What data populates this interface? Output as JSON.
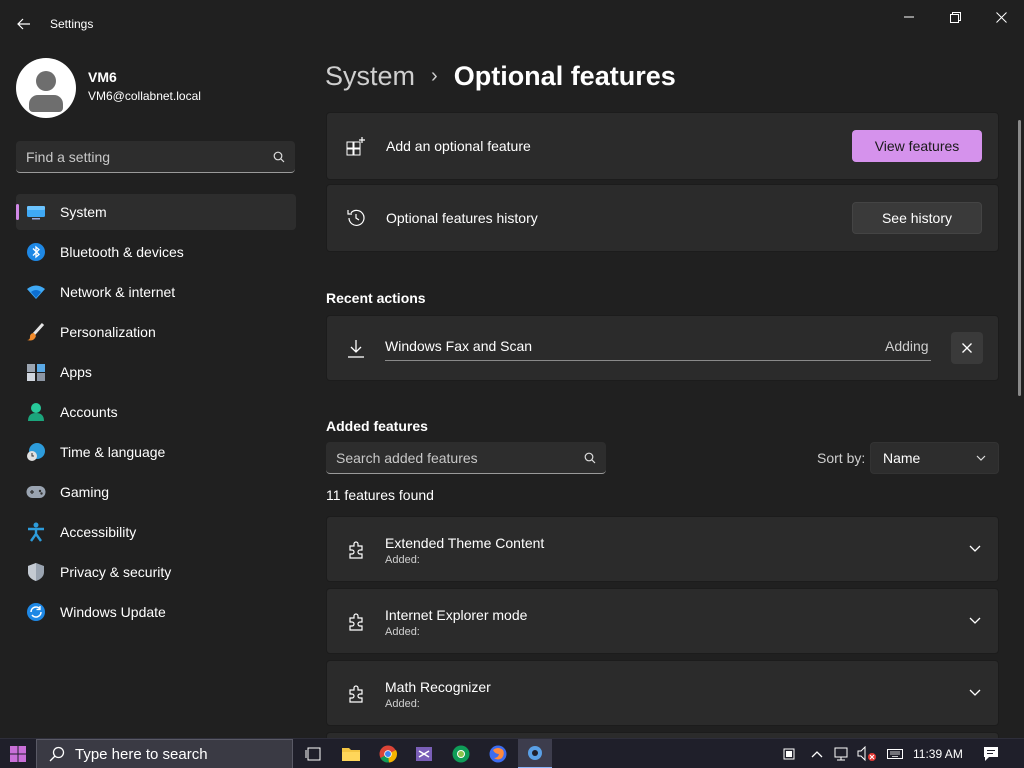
{
  "window": {
    "app_title": "Settings"
  },
  "profile": {
    "name": "VM6",
    "email": "VM6@collabnet.local"
  },
  "sidebar": {
    "search_placeholder": "Find a setting",
    "items": [
      {
        "label": "System",
        "icon": "monitor-icon",
        "active": true
      },
      {
        "label": "Bluetooth & devices",
        "icon": "bluetooth-icon"
      },
      {
        "label": "Network & internet",
        "icon": "wifi-icon"
      },
      {
        "label": "Personalization",
        "icon": "brush-icon"
      },
      {
        "label": "Apps",
        "icon": "apps-icon"
      },
      {
        "label": "Accounts",
        "icon": "person-icon"
      },
      {
        "label": "Time & language",
        "icon": "globe-clock-icon"
      },
      {
        "label": "Gaming",
        "icon": "gamepad-icon"
      },
      {
        "label": "Accessibility",
        "icon": "accessibility-icon"
      },
      {
        "label": "Privacy & security",
        "icon": "shield-icon"
      },
      {
        "label": "Windows Update",
        "icon": "update-icon"
      }
    ]
  },
  "breadcrumb": {
    "parent": "System",
    "separator": "›",
    "current": "Optional features"
  },
  "add_feature": {
    "label": "Add an optional feature",
    "button": "View features"
  },
  "history": {
    "label": "Optional features history",
    "button": "See history"
  },
  "recent": {
    "title": "Recent actions",
    "item_name": "Windows Fax and Scan",
    "item_status": "Adding"
  },
  "added": {
    "title": "Added features",
    "search_placeholder": "Search added features",
    "sort_label": "Sort by:",
    "sort_value": "Name",
    "count_text": "11 features found",
    "features": [
      {
        "name": "Extended Theme Content",
        "status": "Added:"
      },
      {
        "name": "Internet Explorer mode",
        "status": "Added:"
      },
      {
        "name": "Math Recognizer",
        "status": "Added:"
      }
    ]
  },
  "taskbar": {
    "search_placeholder": "Type here to search",
    "time": "11:39 AM"
  },
  "colors": {
    "accent": "#d592ec",
    "background": "#202020",
    "card": "#2b2b2b"
  }
}
